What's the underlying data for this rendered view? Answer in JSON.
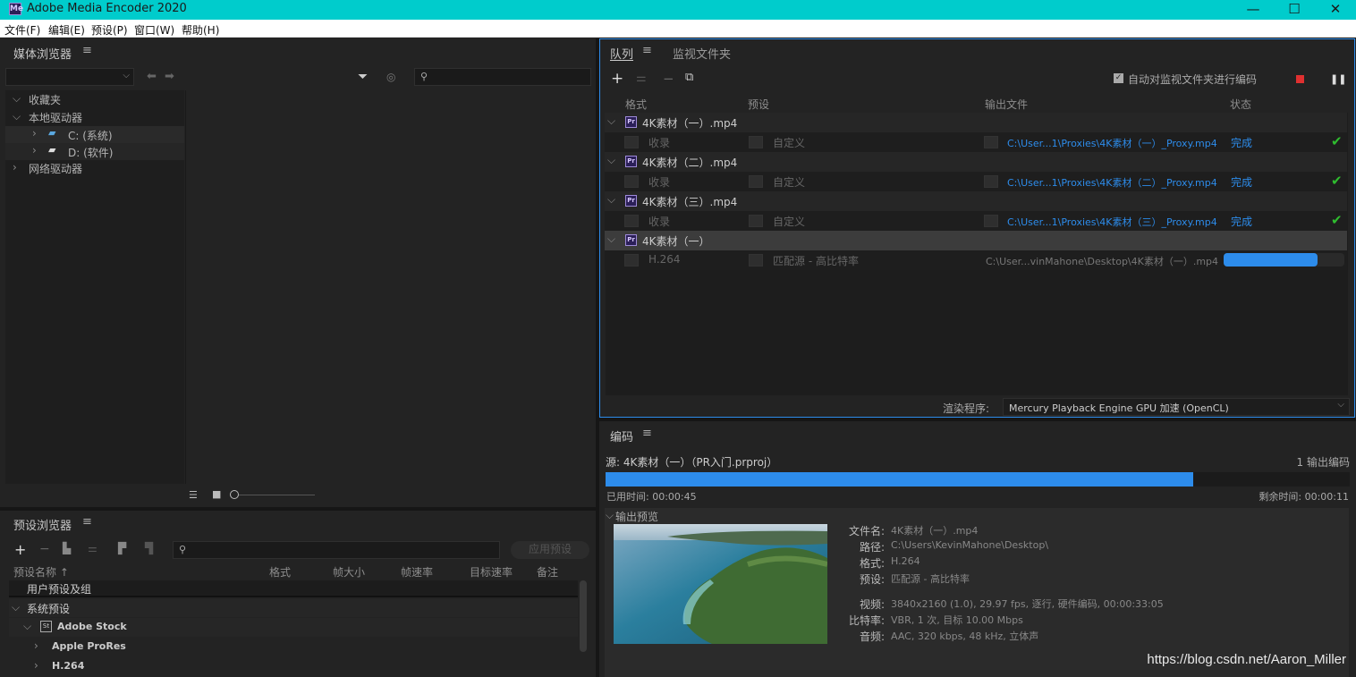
{
  "window": {
    "title": "Adobe Media Encoder 2020",
    "min": "—",
    "max": "☐",
    "close": "✕"
  },
  "menu": [
    "文件(F)",
    "编辑(E)",
    "预设(P)",
    "窗口(W)",
    "帮助(H)"
  ],
  "media_browser": {
    "title": "媒体浏览器",
    "tree": [
      {
        "label": "收藏夹"
      },
      {
        "label": "本地驱动器"
      },
      {
        "label": "C: (系统)"
      },
      {
        "label": "D: (软件)"
      },
      {
        "label": "网络驱动器"
      }
    ]
  },
  "preset_browser": {
    "title": "预设浏览器",
    "apply_label": "应用预设",
    "columns": [
      "预设名称 ↑",
      "格式",
      "帧大小",
      "帧速率",
      "目标速率",
      "备注"
    ],
    "rows": [
      "用户预设及组",
      "系统预设",
      "Adobe Stock",
      "Apple ProRes",
      "H.264"
    ]
  },
  "queue": {
    "tab_queue": "队列",
    "tab_watch": "监视文件夹",
    "auto_encode_label": "自动对监视文件夹进行编码",
    "columns": {
      "format": "格式",
      "preset": "预设",
      "output": "输出文件",
      "status": "状态"
    },
    "groups": [
      {
        "name": "4K素材（一）.mp4",
        "format": "收录",
        "preset": "自定义",
        "output": "C:\\User...1\\Proxies\\4K素材（一）_Proxy.mp4",
        "status": "完成"
      },
      {
        "name": "4K素材（二）.mp4",
        "format": "收录",
        "preset": "自定义",
        "output": "C:\\User...1\\Proxies\\4K素材（二）_Proxy.mp4",
        "status": "完成"
      },
      {
        "name": "4K素材（三）.mp4",
        "format": "收录",
        "preset": "自定义",
        "output": "C:\\User...1\\Proxies\\4K素材（三）_Proxy.mp4",
        "status": "完成"
      },
      {
        "name": "4K素材（一）",
        "format": "H.264",
        "preset": "匹配源 - 高比特率",
        "output": "C:\\User...vinMahone\\Desktop\\4K素材（一）.mp4",
        "progress": 0.78
      }
    ],
    "renderer_label": "渲染程序:",
    "renderer_value": "Mercury Playback Engine GPU 加速 (OpenCL)"
  },
  "encoding": {
    "title": "编码",
    "source": "源: 4K素材（一）（PR入门.prproj）",
    "outputs": "1 输出编码",
    "progress": 0.79,
    "elapsed": "已用时间: 00:00:45",
    "remaining": "剩余时间: 00:00:11",
    "preview_label": "输出预览",
    "info": [
      {
        "k": "文件名:",
        "v": "4K素材（一）.mp4"
      },
      {
        "k": "路径:",
        "v": "C:\\Users\\KevinMahone\\Desktop\\"
      },
      {
        "k": "格式:",
        "v": "H.264"
      },
      {
        "k": "预设:",
        "v": "匹配源 - 高比特率"
      },
      {
        "k": "视频:",
        "v": "3840x2160 (1.0), 29.97 fps, 逐行, 硬件编码, 00:00:33:05"
      },
      {
        "k": "比特率:",
        "v": "VBR, 1 次, 目标 10.00 Mbps"
      },
      {
        "k": "音频:",
        "v": "AAC, 320 kbps, 48 kHz, 立体声"
      }
    ]
  },
  "watermark": "https://blog.csdn.net/Aaron_Miller",
  "colors": {
    "accent": "#2d8ceb",
    "titlebar": "#00cccc",
    "done": "#2fbd2f",
    "stop": "#e03030"
  }
}
